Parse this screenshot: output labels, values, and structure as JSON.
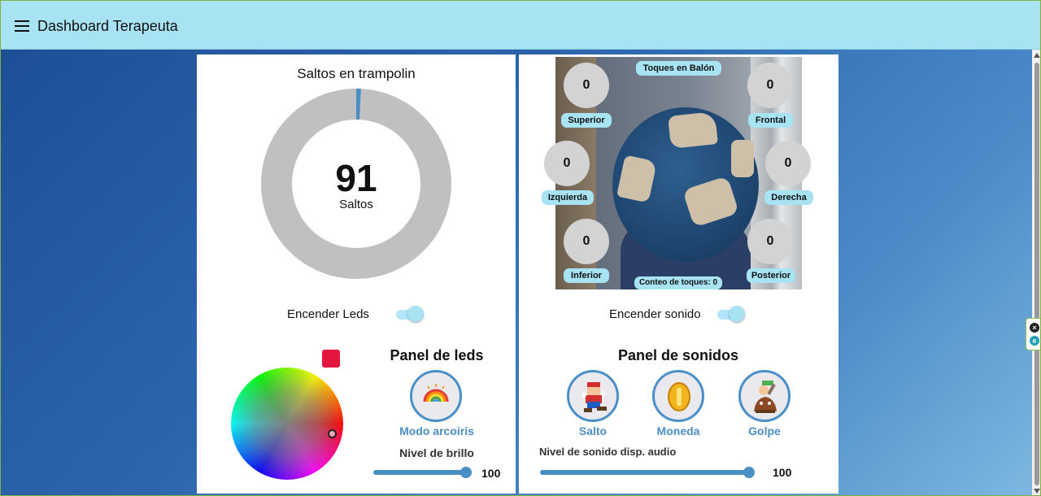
{
  "app": {
    "title": "Dashboard Terapeuta"
  },
  "trampoline": {
    "title": "Saltos en trampolin",
    "count": "91",
    "unit_label": "Saltos",
    "progress_fraction": 0.008
  },
  "leds": {
    "toggle_label": "Encender Leds",
    "toggle_on": true,
    "panel_title": "Panel de leds",
    "selected_color": "#e2163e",
    "rainbow_button_label": "Modo arcoiris",
    "brightness_label": "Nivel de brillo",
    "brightness_value": "100"
  },
  "ball": {
    "title": "Toques en Balón",
    "sensors": [
      {
        "label": "Superior",
        "value": "0"
      },
      {
        "label": "Frontal",
        "value": "0"
      },
      {
        "label": "Izquierda",
        "value": "0"
      },
      {
        "label": "Derecha",
        "value": "0"
      },
      {
        "label": "Inferior",
        "value": "0"
      },
      {
        "label": "Posterior",
        "value": "0"
      }
    ],
    "total_label": "Conteo de toques: 0"
  },
  "sound": {
    "toggle_label": "Encender sonido",
    "toggle_on": true,
    "panel_title": "Panel de sonidos",
    "buttons": [
      {
        "label": "Salto",
        "icon": "mario-jump-icon"
      },
      {
        "label": "Moneda",
        "icon": "coin-icon"
      },
      {
        "label": "Golpe",
        "icon": "hammer-hit-icon"
      }
    ],
    "volume_label": "Nivel de sonido disp. audio",
    "volume_value": "100"
  },
  "colors": {
    "topbar": "#a8e3f4",
    "accent": "#4a8fc4",
    "donut_track": "#c0c0c0",
    "donut_fill": "#4a8fc4"
  }
}
